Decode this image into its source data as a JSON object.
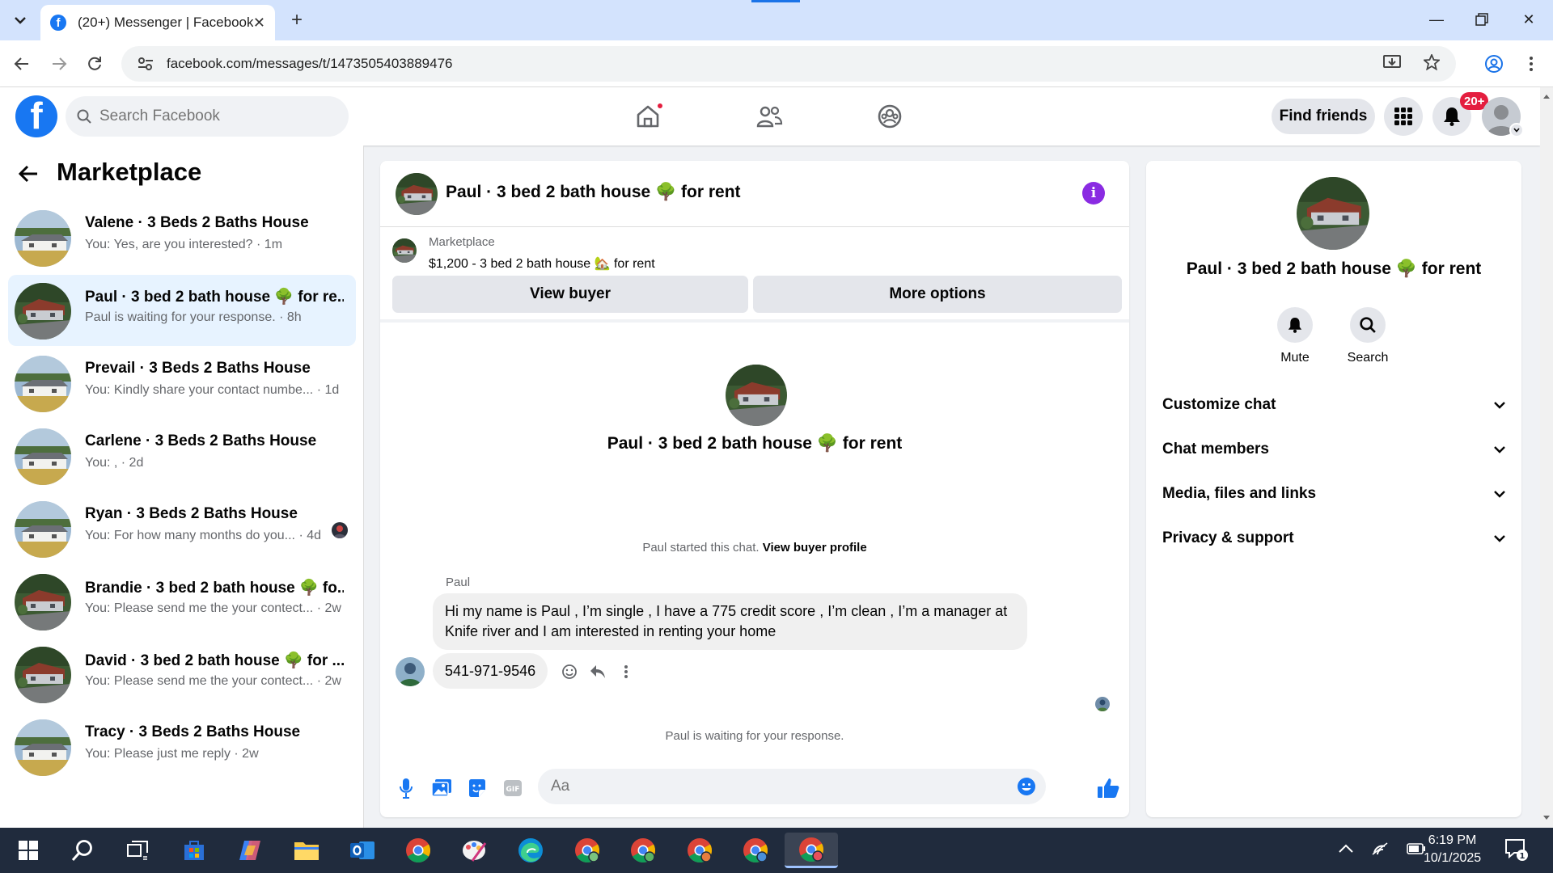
{
  "browser": {
    "tab_title": "(20+) Messenger | Facebook",
    "url": "facebook.com/messages/t/1473505403889476"
  },
  "fb": {
    "logo": "f",
    "search_placeholder": "Search Facebook",
    "find_friends": "Find friends",
    "notif_badge": "20+"
  },
  "sidebar": {
    "title": "Marketplace",
    "conversations": [
      {
        "name": "Valene · 3 Beds 2 Baths House",
        "preview": "You: Yes, are you interested? · 1m",
        "house": "light"
      },
      {
        "name": "Paul · 3 bed 2 bath house 🌳 for re...",
        "preview": "Paul is waiting for your response. · 8h",
        "house": "dark"
      },
      {
        "name": "Prevail · 3 Beds 2 Baths House",
        "preview": "You: Kindly share your contact numbe...  · 1d",
        "house": "light"
      },
      {
        "name": "Carlene · 3 Beds 2 Baths House",
        "preview": "You: , · 2d",
        "house": "light"
      },
      {
        "name": "Ryan · 3 Beds 2 Baths House",
        "preview": "You: For how many months do you...  · 4d",
        "house": "light"
      },
      {
        "name": "Brandie · 3 bed 2 bath house 🌳 fo...",
        "preview": "You: Please send me the your contect...  · 2w",
        "house": "dark"
      },
      {
        "name": "David · 3 bed 2 bath house 🌳 for ...",
        "preview": "You: Please send me the your contect...  · 2w",
        "house": "dark"
      },
      {
        "name": "Tracy · 3 Beds 2 Baths House",
        "preview": "You: Please just me reply · 2w",
        "house": "light"
      }
    ]
  },
  "chat": {
    "title": "Paul · 3 bed 2 bath house 🌳 for rent",
    "marketplace_label": "Marketplace",
    "listing": "$1,200 - 3 bed 2 bath house 🏡 for rent",
    "view_buyer": "View buyer",
    "more_options": "More options",
    "started_text": "Paul started this chat.",
    "view_buyer_profile": "View buyer profile",
    "sender": "Paul",
    "message1": "Hi my name is Paul , I’m single , I have a 775 credit score , I’m clean , I’m a manager at Knife river and I am interested in renting your home",
    "message2": "541-971-9546",
    "waiting": "Paul is waiting for your response.",
    "input_placeholder": "Aa"
  },
  "panel": {
    "title": "Paul · 3 bed 2 bath house 🌳 for rent",
    "mute": "Mute",
    "search": "Search",
    "sections": [
      "Customize chat",
      "Chat members",
      "Media, files and links",
      "Privacy & support"
    ]
  },
  "taskbar": {
    "time": "6:19 PM",
    "date": "10/1/2025"
  },
  "colors": {
    "fb_blue": "#1877f2",
    "active_conv": "#e7f3ff",
    "notif_red": "#e41e3f",
    "info_purple": "#8a2be2"
  }
}
